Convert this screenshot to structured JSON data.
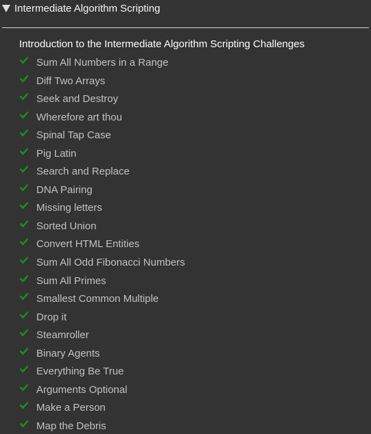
{
  "section": {
    "title": "Intermediate Algorithm Scripting",
    "expanded_icon": "caret-down-icon"
  },
  "intro": {
    "label": "Introduction to the Intermediate Algorithm Scripting Challenges"
  },
  "check_icon": "checkmark-icon",
  "colors": {
    "background": "#333333",
    "check": "#1f8a1f",
    "completed_text": "#c2c2c2",
    "title_text": "#f5f5f5"
  },
  "challenges": [
    {
      "label": "Sum All Numbers in a Range",
      "completed": true
    },
    {
      "label": "Diff Two Arrays",
      "completed": true
    },
    {
      "label": "Seek and Destroy",
      "completed": true
    },
    {
      "label": "Wherefore art thou",
      "completed": true
    },
    {
      "label": "Spinal Tap Case",
      "completed": true
    },
    {
      "label": "Pig Latin",
      "completed": true
    },
    {
      "label": "Search and Replace",
      "completed": true
    },
    {
      "label": "DNA Pairing",
      "completed": true
    },
    {
      "label": "Missing letters",
      "completed": true
    },
    {
      "label": "Sorted Union",
      "completed": true
    },
    {
      "label": "Convert HTML Entities",
      "completed": true
    },
    {
      "label": "Sum All Odd Fibonacci Numbers",
      "completed": true
    },
    {
      "label": "Sum All Primes",
      "completed": true
    },
    {
      "label": "Smallest Common Multiple",
      "completed": true
    },
    {
      "label": "Drop it",
      "completed": true
    },
    {
      "label": "Steamroller",
      "completed": true
    },
    {
      "label": "Binary Agents",
      "completed": true
    },
    {
      "label": "Everything Be True",
      "completed": true
    },
    {
      "label": "Arguments Optional",
      "completed": true
    },
    {
      "label": "Make a Person",
      "completed": true
    },
    {
      "label": "Map the Debris",
      "completed": true
    }
  ]
}
